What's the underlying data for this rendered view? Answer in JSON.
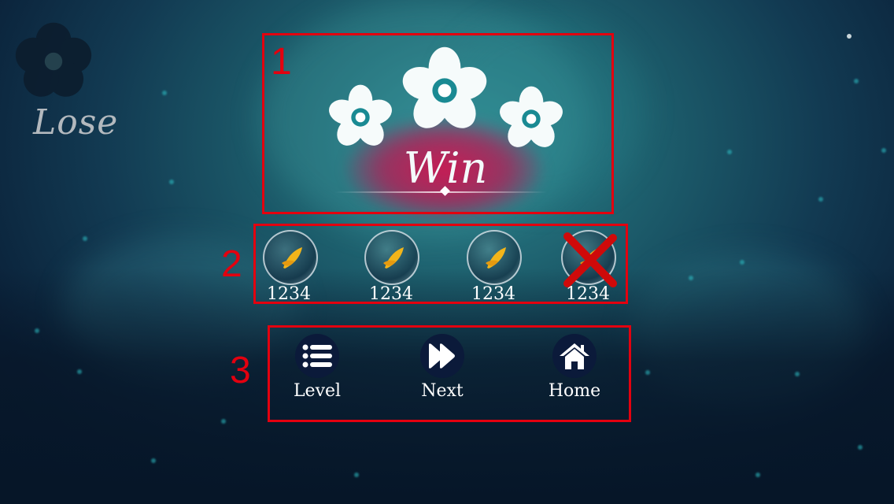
{
  "lose": {
    "label": "Lose"
  },
  "result": {
    "title": "Win"
  },
  "annotations": [
    "1",
    "2",
    "3"
  ],
  "rewards": [
    {
      "count": "1234",
      "crossed": false
    },
    {
      "count": "1234",
      "crossed": false
    },
    {
      "count": "1234",
      "crossed": false
    },
    {
      "count": "1234",
      "crossed": true
    }
  ],
  "actions": [
    {
      "label": "Level",
      "icon": "list-icon"
    },
    {
      "label": "Next",
      "icon": "fast-forward-icon"
    },
    {
      "label": "Home",
      "icon": "home-icon"
    }
  ],
  "colors": {
    "annotation": "#e3000f",
    "glow": "#d2144f",
    "flower": "#ffffff",
    "icon_bg": "#0b1a3a"
  }
}
